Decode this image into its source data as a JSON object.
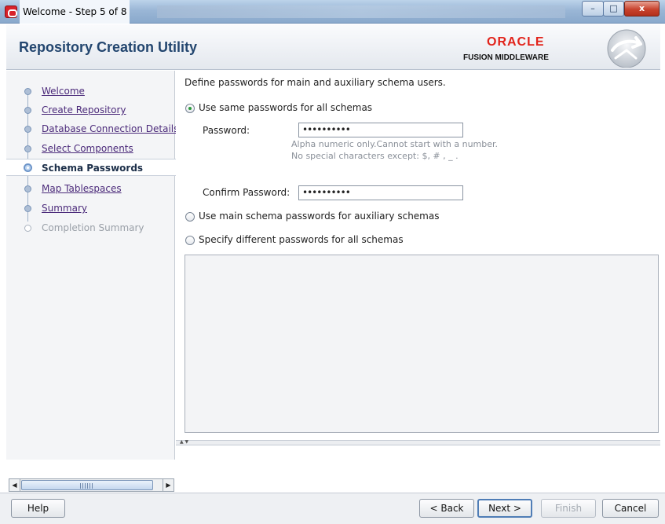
{
  "window": {
    "title": "Welcome - Step 5 of 8",
    "controls": {
      "minimize": "–",
      "maximize": "□",
      "close": "x"
    }
  },
  "header": {
    "title": "Repository Creation Utility",
    "brand": "ORACLE",
    "product": "FUSION MIDDLEWARE"
  },
  "nav": {
    "items": [
      {
        "label": "Welcome",
        "state": "done"
      },
      {
        "label": "Create Repository",
        "state": "done"
      },
      {
        "label": "Database Connection Details",
        "state": "done"
      },
      {
        "label": "Select Components",
        "state": "done"
      },
      {
        "label": "Schema Passwords",
        "state": "current"
      },
      {
        "label": "Map Tablespaces",
        "state": "next"
      },
      {
        "label": "Summary",
        "state": "next"
      },
      {
        "label": "Completion Summary",
        "state": "disabled"
      }
    ]
  },
  "content": {
    "intro": "Define passwords for main and auxiliary schema users.",
    "option_same": "Use same passwords for all schemas",
    "password_label": "Password:",
    "password_value": "••••••••••",
    "hint_line1": "Alpha numeric only.Cannot start with a number.",
    "hint_line2": "No special characters except: $, # , _ .",
    "confirm_label": "Confirm Password:",
    "confirm_value": "••••••••••",
    "option_main": "Use main schema passwords for auxiliary schemas",
    "option_different": "Specify different passwords for all schemas",
    "selected_option": "option_same"
  },
  "footer": {
    "help": "Help",
    "back": "< Back",
    "next": "Next >",
    "finish": "Finish",
    "cancel": "Cancel"
  }
}
